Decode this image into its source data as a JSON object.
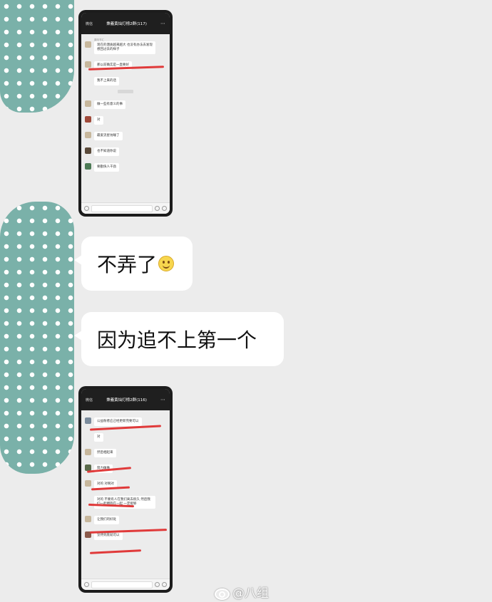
{
  "screenshot_top": {
    "title": "秉義黄灿灯榜2群(117)",
    "back": "微信",
    "messages": [
      {
        "name": "秦阳节汇",
        "text": "现在的潜质越来越大 也没有办法去发现 想回过去的样子"
      },
      {
        "name": "",
        "text": "那以前确实是一直要好"
      },
      {
        "name": "",
        "text": "我不上来的话"
      },
      {
        "name": "",
        "text": "做一些有意义的事"
      },
      {
        "name": "",
        "text": "对"
      },
      {
        "name": "",
        "text": "最爱流星坊睡了"
      },
      {
        "name": "",
        "text": "也不知道你说"
      },
      {
        "name": "",
        "text": "要勤快人干劲"
      }
    ]
  },
  "bubble_1": {
    "text": "不弄了",
    "emoji": "smiley-emoji"
  },
  "bubble_2": {
    "text": "因为追不上第一个"
  },
  "screenshot_bottom": {
    "title": "秉義黄灿灯榜2群(116)",
    "back": "微信",
    "messages": [
      {
        "name": "",
        "text": "公益粉者应己经更新完要可以"
      },
      {
        "name": "",
        "text": "对"
      },
      {
        "name": "",
        "text": "然后相起来"
      },
      {
        "name": "",
        "text": "努力做事"
      },
      {
        "name": "",
        "text": "对的 对啊对"
      },
      {
        "name": "",
        "text": "对的 不要有人在我们离去很久 然后我们一起拥抱在一起 一定能够"
      },
      {
        "name": "",
        "text": "让我们的好处"
      },
      {
        "name": "",
        "text": "坚持到底就可以"
      }
    ]
  },
  "watermark": {
    "text": "@八组"
  }
}
